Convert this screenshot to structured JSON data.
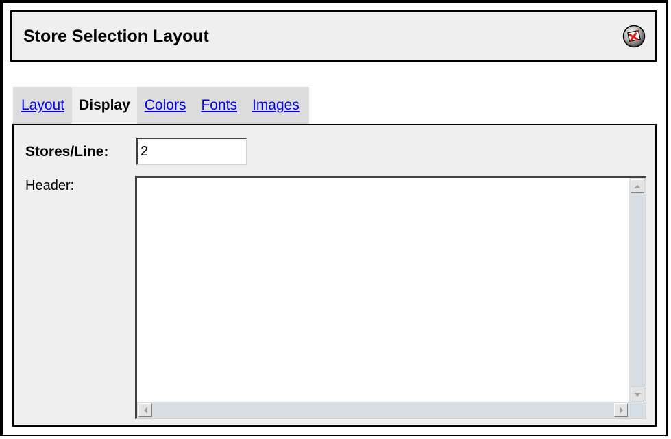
{
  "window": {
    "title": "Store Selection Layout",
    "close_icon": "close-window-icon"
  },
  "tabs": [
    {
      "label": "Layout",
      "active": false
    },
    {
      "label": "Display",
      "active": true
    },
    {
      "label": "Colors",
      "active": false
    },
    {
      "label": "Fonts",
      "active": false
    },
    {
      "label": "Images",
      "active": false
    }
  ],
  "form": {
    "stores_per_line": {
      "label": "Stores/Line:",
      "value": "2"
    },
    "header": {
      "label": "Header:",
      "value": ""
    }
  },
  "colors": {
    "link": "#0000ee",
    "panel_bg": "#efefef",
    "tab_bg": "#dcdcdc",
    "scrollbar": "#d6dde3",
    "close_icon_accent": "#e0201c"
  }
}
